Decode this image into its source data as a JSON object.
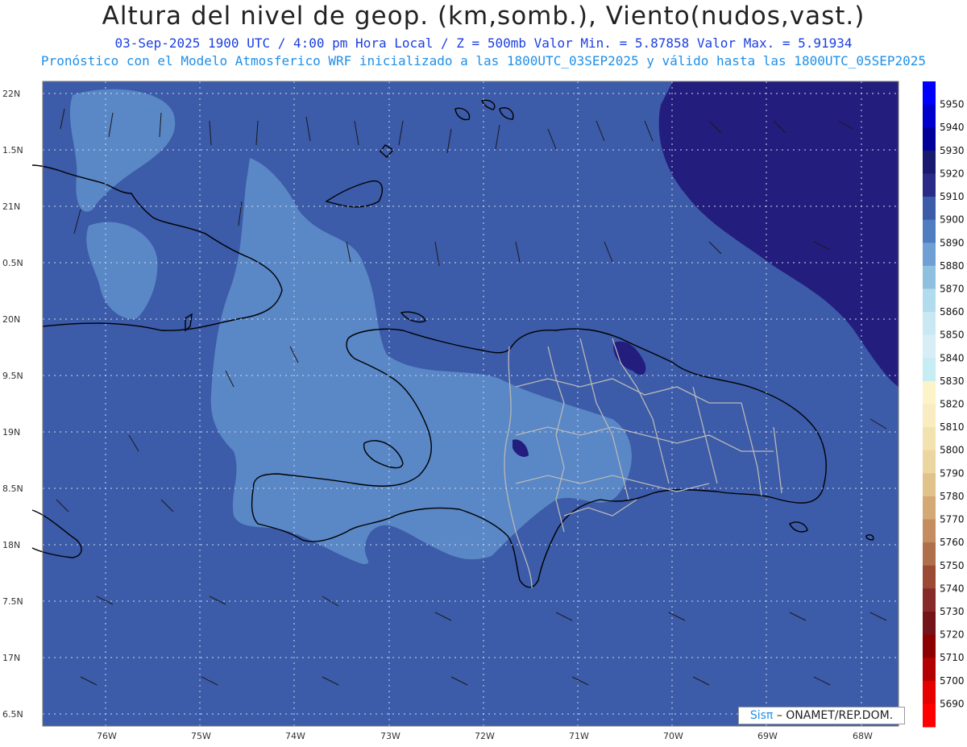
{
  "header": {
    "title": "Altura del nivel de geop. (km,somb.), Viento(nudos,vast.)",
    "subtitle1": "03-Sep-2025  1900 UTC / 4:00 pm Hora Local / Z = 500mb    Valor Min. = 5.87858  Valor Max. = 5.91934",
    "subtitle2": "Pronóstico con el Modelo Atmosferico WRF inicializado a las 1800UTC_03SEP2025 y válido hasta las  1800UTC_05SEP2025"
  },
  "map": {
    "lat_ticks": [
      "22N",
      "1.5N",
      "21N",
      "0.5N",
      "20N",
      "9.5N",
      "19N",
      "8.5N",
      "18N",
      "7.5N",
      "17N",
      "6.5N"
    ],
    "lon_ticks": [
      "76W",
      "75W",
      "74W",
      "73W",
      "72W",
      "71W",
      "70W",
      "69W",
      "68W"
    ],
    "fill_colors": {
      "background": "#3c5ba8",
      "low": "#5a87c6",
      "high": "#231d7e",
      "coast": "#000000",
      "borders": "#b8b8b8"
    }
  },
  "colorbar": {
    "levels": [
      "5950",
      "5940",
      "5930",
      "5920",
      "5910",
      "5900",
      "5890",
      "5880",
      "5870",
      "5860",
      "5850",
      "5840",
      "5830",
      "5820",
      "5810",
      "5800",
      "5790",
      "5780",
      "5770",
      "5760",
      "5750",
      "5740",
      "5730",
      "5720",
      "5710",
      "5700",
      "5690"
    ],
    "colors": [
      "#0000ff",
      "#0000cc",
      "#000099",
      "#191970",
      "#2a2a88",
      "#3c5ba8",
      "#4f7dbf",
      "#6f9fd3",
      "#8fc0e0",
      "#b0dcee",
      "#c9e8f3",
      "#d8eef7",
      "#c6ecf4",
      "#fdf3c8",
      "#f8ecc0",
      "#f2e2b0",
      "#ecd6a0",
      "#e1c28a",
      "#d3a975",
      "#c48d5f",
      "#b06f4b",
      "#9a4a35",
      "#862b28",
      "#741418",
      "#8c0000",
      "#b30000",
      "#e60000",
      "#ff0000"
    ]
  },
  "credit": {
    "brand": "Sisπ",
    "text": "– ONAMET/REP.DOM."
  }
}
